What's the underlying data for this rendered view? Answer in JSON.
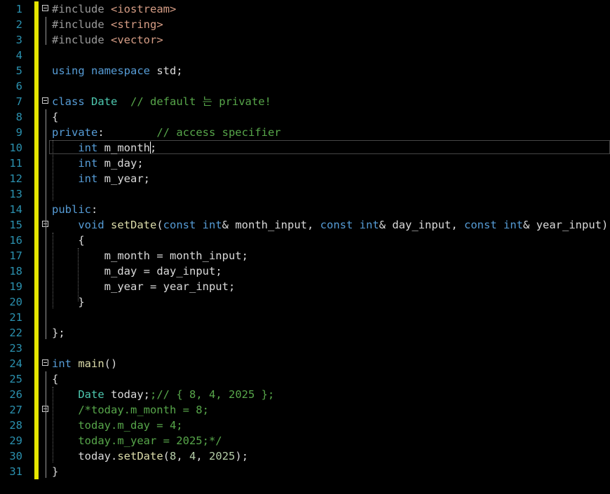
{
  "editor": {
    "lines": [
      {
        "n": "1",
        "tokens": [
          {
            "t": "#include ",
            "c": "pre"
          },
          {
            "t": "<iostream>",
            "c": "st"
          }
        ]
      },
      {
        "n": "2",
        "tokens": [
          {
            "t": "#include ",
            "c": "pre"
          },
          {
            "t": "<string>",
            "c": "st"
          }
        ]
      },
      {
        "n": "3",
        "tokens": [
          {
            "t": "#include ",
            "c": "pre"
          },
          {
            "t": "<vector>",
            "c": "st"
          }
        ]
      },
      {
        "n": "4",
        "tokens": []
      },
      {
        "n": "5",
        "tokens": [
          {
            "t": "using namespace ",
            "c": "kw"
          },
          {
            "t": "std;",
            "c": "var"
          }
        ]
      },
      {
        "n": "6",
        "tokens": []
      },
      {
        "n": "7",
        "tokens": [
          {
            "t": "class ",
            "c": "kw"
          },
          {
            "t": "Date",
            "c": "ty"
          },
          {
            "t": "  // default 는 private!",
            "c": "cm"
          }
        ]
      },
      {
        "n": "8",
        "tokens": [
          {
            "t": "{",
            "c": "var"
          }
        ]
      },
      {
        "n": "9",
        "tokens": [
          {
            "t": "private",
            "c": "kw"
          },
          {
            "t": ":        ",
            "c": "var"
          },
          {
            "t": "// access specifier",
            "c": "cm"
          }
        ]
      },
      {
        "n": "10",
        "tokens": [
          {
            "t": "    int ",
            "c": "kw"
          },
          {
            "t": "m_month;",
            "c": "var"
          }
        ]
      },
      {
        "n": "11",
        "tokens": [
          {
            "t": "    int ",
            "c": "kw"
          },
          {
            "t": "m_day;",
            "c": "var"
          }
        ]
      },
      {
        "n": "12",
        "tokens": [
          {
            "t": "    int ",
            "c": "kw"
          },
          {
            "t": "m_year;",
            "c": "var"
          }
        ]
      },
      {
        "n": "13",
        "tokens": []
      },
      {
        "n": "14",
        "tokens": [
          {
            "t": "public",
            "c": "kw"
          },
          {
            "t": ":",
            "c": "var"
          }
        ]
      },
      {
        "n": "15",
        "tokens": [
          {
            "t": "    void ",
            "c": "kw"
          },
          {
            "t": "setDate",
            "c": "fn"
          },
          {
            "t": "(",
            "c": "var"
          },
          {
            "t": "const int",
            "c": "kw"
          },
          {
            "t": "& ",
            "c": "var"
          },
          {
            "t": "month_input",
            "c": "var"
          },
          {
            "t": ", ",
            "c": "var"
          },
          {
            "t": "const int",
            "c": "kw"
          },
          {
            "t": "& ",
            "c": "var"
          },
          {
            "t": "day_input",
            "c": "var"
          },
          {
            "t": ", ",
            "c": "var"
          },
          {
            "t": "const int",
            "c": "kw"
          },
          {
            "t": "& ",
            "c": "var"
          },
          {
            "t": "year_input",
            "c": "var"
          },
          {
            "t": ")",
            "c": "var"
          }
        ]
      },
      {
        "n": "16",
        "tokens": [
          {
            "t": "    {",
            "c": "var"
          }
        ]
      },
      {
        "n": "17",
        "tokens": [
          {
            "t": "        m_month ",
            "c": "var"
          },
          {
            "t": "= ",
            "c": "var"
          },
          {
            "t": "month_input;",
            "c": "var"
          }
        ]
      },
      {
        "n": "18",
        "tokens": [
          {
            "t": "        m_day ",
            "c": "var"
          },
          {
            "t": "= ",
            "c": "var"
          },
          {
            "t": "day_input;",
            "c": "var"
          }
        ]
      },
      {
        "n": "19",
        "tokens": [
          {
            "t": "        m_year ",
            "c": "var"
          },
          {
            "t": "= ",
            "c": "var"
          },
          {
            "t": "year_input;",
            "c": "var"
          }
        ]
      },
      {
        "n": "20",
        "tokens": [
          {
            "t": "    }",
            "c": "var"
          }
        ]
      },
      {
        "n": "21",
        "tokens": []
      },
      {
        "n": "22",
        "tokens": [
          {
            "t": "};",
            "c": "var"
          }
        ]
      },
      {
        "n": "23",
        "tokens": []
      },
      {
        "n": "24",
        "tokens": [
          {
            "t": "int ",
            "c": "kw"
          },
          {
            "t": "main",
            "c": "fn"
          },
          {
            "t": "()",
            "c": "var"
          }
        ]
      },
      {
        "n": "25",
        "tokens": [
          {
            "t": "{",
            "c": "var"
          }
        ]
      },
      {
        "n": "26",
        "tokens": [
          {
            "t": "    Date ",
            "c": "ty"
          },
          {
            "t": "today;",
            "c": "var"
          },
          {
            "t": ";// { 8, 4, 2025 };",
            "c": "cm"
          }
        ]
      },
      {
        "n": "27",
        "tokens": [
          {
            "t": "    /*today.m_month = 8;",
            "c": "cm"
          }
        ]
      },
      {
        "n": "28",
        "tokens": [
          {
            "t": "    today.m_day = 4;",
            "c": "cm"
          }
        ]
      },
      {
        "n": "29",
        "tokens": [
          {
            "t": "    today.m_year = 2025;*/",
            "c": "cm"
          }
        ]
      },
      {
        "n": "30",
        "tokens": [
          {
            "t": "    today",
            "c": "var"
          },
          {
            "t": ".",
            "c": "var"
          },
          {
            "t": "setDate",
            "c": "fn"
          },
          {
            "t": "(",
            "c": "var"
          },
          {
            "t": "8",
            "c": "nm"
          },
          {
            "t": ", ",
            "c": "var"
          },
          {
            "t": "4",
            "c": "nm"
          },
          {
            "t": ", ",
            "c": "var"
          },
          {
            "t": "2025",
            "c": "nm"
          },
          {
            "t": ");",
            "c": "var"
          }
        ]
      },
      {
        "n": "31",
        "tokens": [
          {
            "t": "}",
            "c": "var"
          }
        ]
      }
    ],
    "fold_lines": [
      "1",
      "7",
      "15",
      "24",
      "27"
    ],
    "change_lines": [
      "1",
      "2",
      "3",
      "4",
      "5",
      "6",
      "7",
      "8",
      "9",
      "10",
      "11",
      "12",
      "13",
      "14",
      "15",
      "16",
      "17",
      "18",
      "19",
      "20",
      "21",
      "22",
      "23",
      "24",
      "25",
      "26",
      "27",
      "28",
      "29",
      "30",
      "31"
    ],
    "current_line": "10"
  }
}
